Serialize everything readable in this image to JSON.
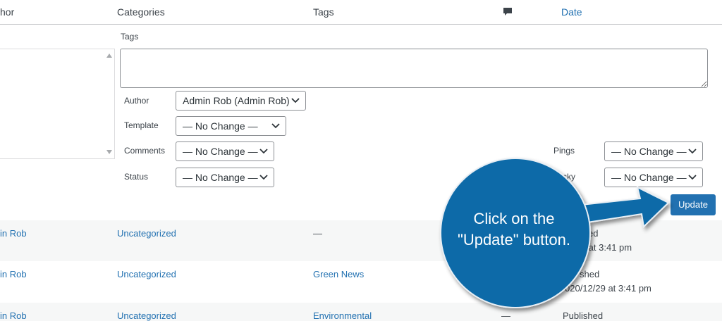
{
  "header": {
    "author": "hor",
    "categories": "Categories",
    "tags": "Tags",
    "comments_icon": "comment-bubble-icon",
    "date": "Date"
  },
  "bulk_edit": {
    "tags_label": "Tags",
    "tags_value": "",
    "author_label": "Author",
    "author_value": "Admin Rob (Admin Rob)",
    "template_label": "Template",
    "template_value": "— No Change —",
    "comments_label": "Comments",
    "comments_value": "— No Change —",
    "status_label": "Status",
    "status_value": "— No Change —",
    "pings_label": "Pings",
    "pings_value": "— No Change —",
    "sticky_label": "cky",
    "sticky_value": "— No Change —",
    "update_label": "Update"
  },
  "rows": [
    {
      "author": "in Rob",
      "category": "Uncategorized",
      "tags": "—",
      "status": "ed",
      "date": "/19 at 3:41 pm"
    },
    {
      "author": "in Rob",
      "category": "Uncategorized",
      "tags": "Green News",
      "status": "shed",
      "date": "020/12/29 at 3:41 pm"
    },
    {
      "author": "in Rob",
      "category": "Uncategorized",
      "tags": "Environmental",
      "comments": "—",
      "status": "Published"
    }
  ],
  "callout": {
    "line1": "Click on the",
    "line2": "\"Update\" button.",
    "color": "#0a6ba8"
  },
  "colors": {
    "accent": "#2271b1",
    "row_alt": "#f6f7f7"
  }
}
